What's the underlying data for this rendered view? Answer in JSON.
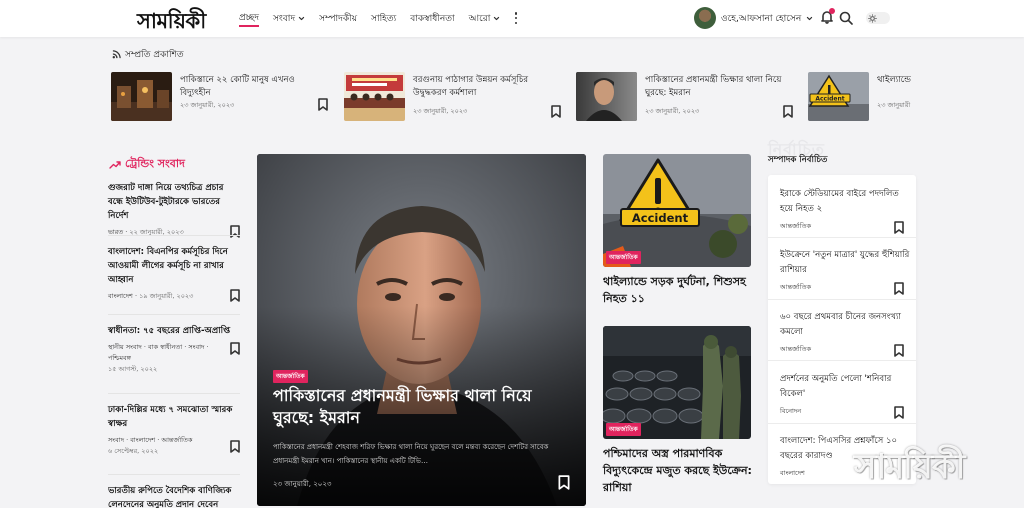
{
  "brand": {
    "logo": "সাময়িকী"
  },
  "nav": {
    "items": [
      {
        "label": "প্রচ্ছদ",
        "active": true,
        "dropdown": false
      },
      {
        "label": "সংবাদ",
        "active": false,
        "dropdown": true
      },
      {
        "label": "সম্পাদকীয়",
        "active": false,
        "dropdown": false
      },
      {
        "label": "সাহিত্য",
        "active": false,
        "dropdown": false
      },
      {
        "label": "বাকস্বাধীনতা",
        "active": false,
        "dropdown": false
      },
      {
        "label": "আরো",
        "active": false,
        "dropdown": true
      }
    ]
  },
  "user": {
    "name": "ওহে,আফসানা হোসেন",
    "has_dropdown": true
  },
  "accent": "#e0245e",
  "latest": {
    "heading": "সম্প্রতি প্রকাশিত",
    "items": [
      {
        "title": "পাকিস্তানে ২২ কোটি মানুষ এখনও বিদ্যুৎহীন",
        "date": "২৩ জানুয়ারী, ২০২৩"
      },
      {
        "title": "বরগুনায় পাঠাগার উন্নয়ন কর্মসূচির উদ্বুদ্ধকরণ কর্মশালা",
        "date": "২৩ জানুয়ারী, ২০২৩"
      },
      {
        "title": "পাকিস্তানের প্রধানমন্ত্রী ভিক্ষার থালা নিয়ে ঘুরছে: ইমরান",
        "date": "২৩ জানুয়ারী, ২০২৩"
      },
      {
        "title": "থাইল্যান্ডে",
        "date": "২৩ জানুয়ারী"
      }
    ]
  },
  "trending": {
    "heading": "ট্রেন্ডিং সংবাদ",
    "items": [
      {
        "title": "গুজরাট দাঙ্গা নিয়ে তথ্যচিত্র প্রচার বন্ধে ইউটিউব-টুইটারকে ভারতের নির্দেশ",
        "tags": [
          "ভারত"
        ],
        "date": "২২ জানুয়ারী, ২০২৩"
      },
      {
        "title": "বাংলাদেশ: বিএনপির কর্মসূচির দিনে আওয়ামী লীগের কর্মসূচি না রাখার আহ্বান",
        "tags": [
          "বাংলাদেশ"
        ],
        "date": "১৯ জানুয়ারী, ২০২৩"
      },
      {
        "title": "স্বাধীনতা: ৭৫ বছরের প্রাপ্তি-অপ্রাপ্তি",
        "tags": [
          "স্থানীয় সংবাদ",
          "বাক স্বাধীনতা",
          "সংবাদ",
          "পশ্চিমবঙ্গ"
        ],
        "date": "১৫ আগস্ট, ২০২২"
      },
      {
        "title": "ঢাকা-দিল্লির মধ্যে ৭ সমঝোতা স্মারক স্বাক্ষর",
        "tags": [
          "সংবাদ",
          "বাংলাদেশ",
          "আন্তর্জাতিক"
        ],
        "date": "৬ সেপ্টেম্বর, ২০২২"
      },
      {
        "title": "ভারতীয় রুপিতে বৈদেশিক বাণিজ্যিক লেনদেনের অনুমতি প্রদান দেবেন",
        "tags": [],
        "date": ""
      }
    ]
  },
  "featured": {
    "category": "আন্তর্জাতিক",
    "title": "পাকিস্তানের প্রধানমন্ত্রী ভিক্ষার থালা নিয়ে ঘুরছে: ইমরান",
    "excerpt": "পাকিস্তানের প্রধানমন্ত্রী শেহবাজ শরিফ ভিক্ষার থালা নিয়ে ঘুরছেন বলে মন্তব্য করেছেন দেশটির সাবেক প্রধানমন্ত্রী ইমরান খান। পাকিস্তানের স্থানীয় একটি টিভি…",
    "date": "২৩ জানুয়ারী, ২০২৩"
  },
  "middle": [
    {
      "category": "আন্তর্জাতিক",
      "title": "থাইল্যান্ডে সড়ক দুর্ঘটনা, শিশুসহ নিহত ১১",
      "image_label": "Accident"
    },
    {
      "category": "আন্তর্জাতিক",
      "title": "পশ্চিমাদের অস্ত্র পারমাণবিক বিদ্যুৎকেন্দ্রে মজুত করছে ইউক্রেন: রাশিয়া"
    }
  ],
  "editors_pick": {
    "heading": "সম্পাদক নির্বাচিত",
    "ghost": "নির্বাচিত",
    "items": [
      {
        "title": "ইরাকে স্টেডিয়ামের বাইরে পদদলিত হয়ে নিহত ২",
        "category": "আন্তর্জাতিক"
      },
      {
        "title": "ইউক্রেনে 'নতুন মাত্রার' যুদ্ধের হুঁশিয়ারি রাশিয়ার",
        "category": "আন্তর্জাতিক"
      },
      {
        "title": "৬০ বছরে প্রথমবার চীনের জনসংখ্যা কমলো",
        "category": "আন্তর্জাতিক"
      },
      {
        "title": "প্রদর্শনের অনুমতি পেলো 'শনিবার বিকেল'",
        "category": "বিনোদন"
      },
      {
        "title": "বাংলাদেশ: পিএসসির প্রশ্নফাঁসে ১০ বছরের কারাদণ্ড",
        "category": "বাংলাদেশ"
      }
    ]
  },
  "watermark": "সাময়িকী"
}
